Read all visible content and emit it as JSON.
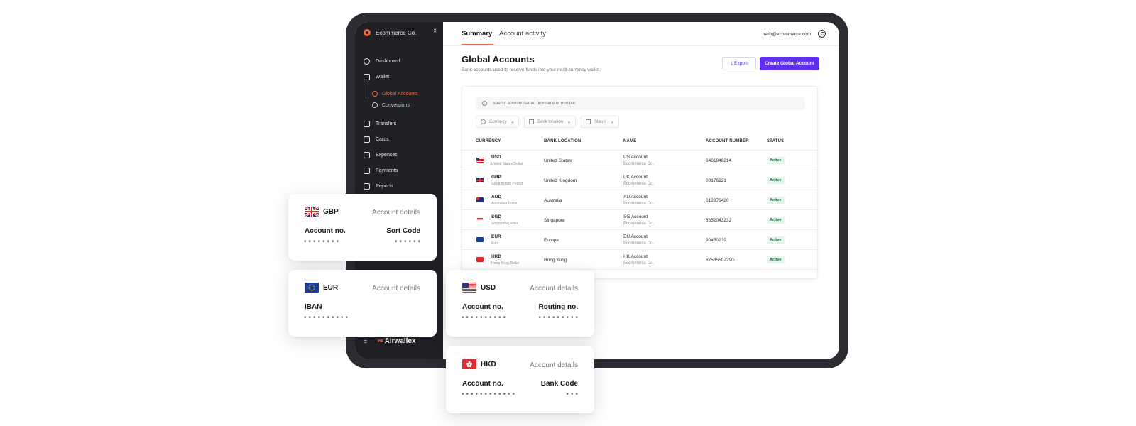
{
  "sidebar": {
    "org_name": "Ecommerce Co.",
    "items": [
      {
        "label": "Dashboard",
        "icon": "dashboard-icon"
      },
      {
        "label": "Wallet",
        "icon": "wallet-icon"
      },
      {
        "label": "Transfers",
        "icon": "transfers-icon"
      },
      {
        "label": "Cards",
        "icon": "cards-icon"
      },
      {
        "label": "Expenses",
        "icon": "expenses-icon"
      },
      {
        "label": "Payments",
        "icon": "payments-icon"
      },
      {
        "label": "Reports",
        "icon": "reports-icon"
      }
    ],
    "sub_items": [
      {
        "label": "Global Accounts",
        "icon": "globe-icon",
        "active": true
      },
      {
        "label": "Conversions",
        "icon": "conversions-icon",
        "active": false
      }
    ],
    "brand": "Airwallex"
  },
  "topbar": {
    "tabs": [
      "Summary",
      "Account activity"
    ],
    "email": "hello@ecommerce.com"
  },
  "page": {
    "title": "Global Accounts",
    "subtitle": "Bank accounts used to receive funds into your multi-currency wallet.",
    "export_label": "Export",
    "create_label": "Create Global Account"
  },
  "search": {
    "placeholder": "Search account name, nickname or number"
  },
  "filters": [
    "Currency",
    "Bank location",
    "Status"
  ],
  "table": {
    "headers": [
      "CURRENCY",
      "BANK LOCATION",
      "NAME",
      "ACCOUNT NUMBER",
      "STATUS"
    ],
    "rows": [
      {
        "code": "USD",
        "currency_name": "United States Dollar",
        "location": "United States",
        "name": "US Account",
        "company": "Ecommerce Co.",
        "number": "8461948214",
        "status": "Active"
      },
      {
        "code": "GBP",
        "currency_name": "Great Britain Pound",
        "location": "United Kingdom",
        "name": "UK Account",
        "company": "Ecommerce Co.",
        "number": "00176921",
        "status": "Active"
      },
      {
        "code": "AUD",
        "currency_name": "Australian Dollar",
        "location": "Australia",
        "name": "AU Account",
        "company": "Ecommerce Co.",
        "number": "612876420",
        "status": "Active"
      },
      {
        "code": "SGD",
        "currency_name": "Singapore Dollar",
        "location": "Singapore",
        "name": "SG Account",
        "company": "Ecommerce Co.",
        "number": "8852043232",
        "status": "Active"
      },
      {
        "code": "EUR",
        "currency_name": "Euro",
        "location": "Europe",
        "name": "EU Account",
        "company": "Ecommerce Co.",
        "number": "90450239",
        "status": "Active"
      },
      {
        "code": "HKD",
        "currency_name": "Hong Kong Dollar",
        "location": "Hong Kong",
        "name": "HK Account",
        "company": "Ecommerce Co.",
        "number": "87535507290",
        "status": "Active"
      }
    ]
  },
  "cards": {
    "gbp": {
      "code": "GBP",
      "details": "Account details",
      "left_label": "Account no.",
      "right_label": "Sort Code",
      "left_dots": "••••••••",
      "right_dots": "••••••"
    },
    "eur": {
      "code": "EUR",
      "details": "Account details",
      "left_label": "IBAN",
      "right_label": "",
      "left_dots": "••••••••••",
      "right_dots": ""
    },
    "usd": {
      "code": "USD",
      "details": "Account details",
      "left_label": "Account no.",
      "right_label": "Routing no.",
      "left_dots": "••••••••••",
      "right_dots": "•••••••••"
    },
    "hkd": {
      "code": "HKD",
      "details": "Account details",
      "left_label": "Account no.",
      "right_label": "Bank Code",
      "left_dots": "••••••••••••",
      "right_dots": "•••"
    }
  },
  "colors": {
    "accent": "#f26a3d",
    "primary": "#612fef",
    "sidebar_bg": "#1f2126",
    "frame": "#2b2d33",
    "status_bg": "#e4f6ea"
  }
}
